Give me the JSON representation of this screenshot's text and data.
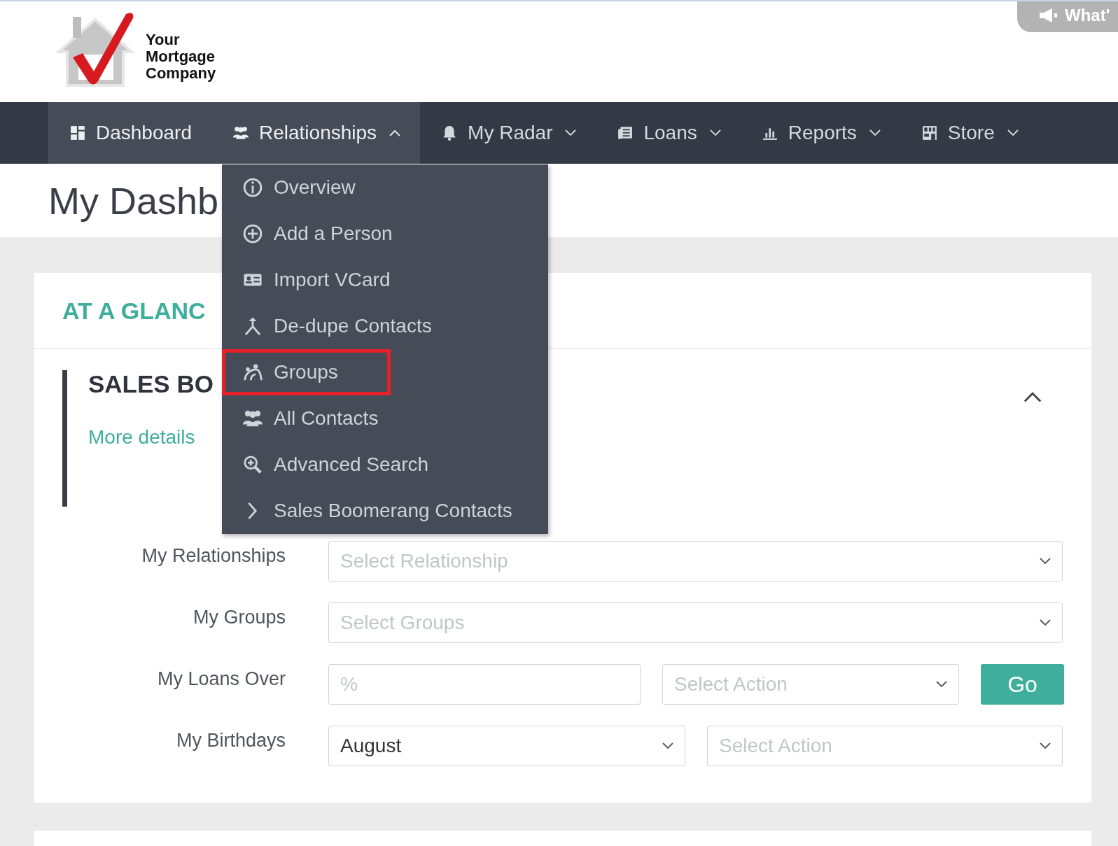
{
  "logo": {
    "lines": [
      "Your",
      "Mortgage",
      "Company"
    ]
  },
  "whats_new_tab": {
    "label": "What'"
  },
  "nav": [
    {
      "label": "Dashboard",
      "kind": "link",
      "selected": true
    },
    {
      "label": "Relationships",
      "kind": "dropdown",
      "selected": true,
      "expanded": true
    },
    {
      "label": "My Radar",
      "kind": "dropdown",
      "selected": false,
      "expanded": false
    },
    {
      "label": "Loans",
      "kind": "dropdown",
      "selected": false,
      "expanded": false
    },
    {
      "label": "Reports",
      "kind": "dropdown",
      "selected": false,
      "expanded": false
    },
    {
      "label": "Store",
      "kind": "dropdown",
      "selected": false,
      "expanded": false
    }
  ],
  "page_title": "My Dashb",
  "dropdown_menu": [
    {
      "label": "Overview",
      "highlighted": false
    },
    {
      "label": "Add a Person",
      "highlighted": false
    },
    {
      "label": "Import VCard",
      "highlighted": false
    },
    {
      "label": "De-dupe Contacts",
      "highlighted": false
    },
    {
      "label": "Groups",
      "highlighted": true
    },
    {
      "label": "All Contacts",
      "highlighted": false
    },
    {
      "label": "Advanced Search",
      "highlighted": false
    },
    {
      "label": "Sales Boomerang Contacts",
      "highlighted": false
    }
  ],
  "card": {
    "title": "AT A GLANC",
    "section": {
      "title": "SALES BO",
      "link": "More details",
      "expanded": true
    },
    "rows": [
      {
        "label": "My Relationships",
        "fields": [
          {
            "kind": "select",
            "placeholder": "Select Relationship"
          }
        ]
      },
      {
        "label": "My Groups",
        "fields": [
          {
            "kind": "select",
            "placeholder": "Select Groups"
          }
        ]
      },
      {
        "label": "My Loans Over",
        "fields": [
          {
            "kind": "input",
            "placeholder": "%"
          },
          {
            "kind": "select",
            "placeholder": "Select Action"
          },
          {
            "kind": "button",
            "label": "Go"
          }
        ]
      },
      {
        "label": "My Birthdays",
        "fields": [
          {
            "kind": "select",
            "value": "August"
          },
          {
            "kind": "select",
            "placeholder": "Select Action"
          }
        ]
      }
    ]
  }
}
